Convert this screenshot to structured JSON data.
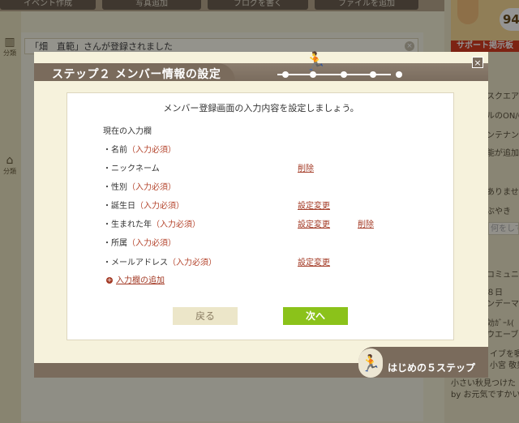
{
  "background": {
    "toolbar": [
      "イベント作成",
      "写真追加",
      "ブログを書く",
      "ファイルを追加"
    ],
    "notice_text": "「畑　直範」さんが登録されました",
    "left_icon_label": "分類",
    "support_count": "94",
    "support_button": "サポート掲示板",
    "right_items": [
      "スクエア",
      "ルのON/O",
      "ンテナンス",
      "能が追加",
      "ありませ",
      "ぶやき",
      "何をして",
      "コミュニ",
      "８日",
      "ンデーマ",
      "効ｶﾞｰﾙ(",
      "ウエーブ"
    ],
    "bottom_items": [
      "イブを嘱",
      "小宮 敬男",
      "小さい秋見つけた",
      "by お元気ですかい"
    ]
  },
  "modal": {
    "title": "ステップ２ メンバー情報の設定",
    "close_label": "×",
    "heading": "メンバー登録画面の入力内容を設定しましょう。",
    "section_label": "現在の入力欄",
    "fields": [
      {
        "label": "・名前",
        "required": "（入力必須）",
        "change": "",
        "delete": ""
      },
      {
        "label": "・ニックネーム",
        "required": "",
        "change": "",
        "delete": "削除"
      },
      {
        "label": "・性別",
        "required": "（入力必須）",
        "change": "",
        "delete": ""
      },
      {
        "label": "・誕生日",
        "required": "（入力必須）",
        "change": "設定変更",
        "delete": ""
      },
      {
        "label": "・生まれた年",
        "required": "（入力必須）",
        "change": "設定変更",
        "delete": "削除"
      },
      {
        "label": "・所属",
        "required": "（入力必須）",
        "change": "",
        "delete": ""
      },
      {
        "label": "・メールアドレス",
        "required": "（入力必須）",
        "change": "設定変更",
        "delete": ""
      }
    ],
    "add_field": "入力欄の追加",
    "back_button": "戻る",
    "next_button": "次へ",
    "steps_badge": "はじめの５ステップ"
  }
}
